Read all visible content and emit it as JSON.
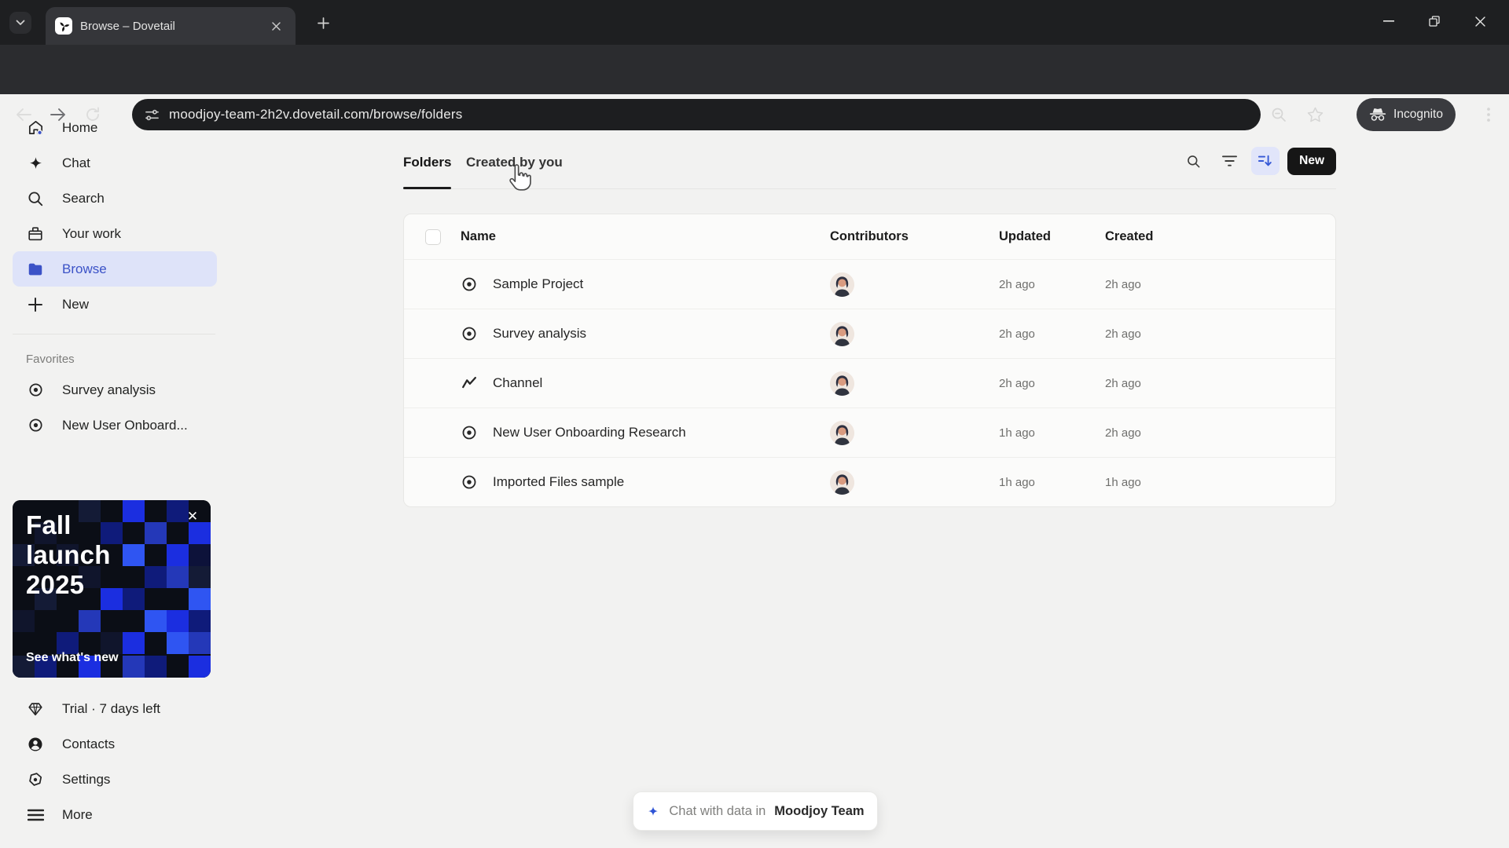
{
  "browser": {
    "tab_title": "Browse – Dovetail",
    "url": "moodjoy-team-2h2v.dovetail.com/browse/folders",
    "incognito_label": "Incognito"
  },
  "sidebar": {
    "items": [
      {
        "label": "Home",
        "icon": "home-icon"
      },
      {
        "label": "Chat",
        "icon": "sparkle-icon"
      },
      {
        "label": "Search",
        "icon": "search-icon"
      },
      {
        "label": "Your work",
        "icon": "archive-icon"
      },
      {
        "label": "Browse",
        "icon": "folder-icon",
        "active": true
      },
      {
        "label": "New",
        "icon": "plus-icon"
      }
    ],
    "favorites_label": "Favorites",
    "favorites": [
      {
        "label": "Survey analysis",
        "icon": "project-icon"
      },
      {
        "label": "New User Onboard...",
        "icon": "project-icon"
      }
    ],
    "promo": {
      "title": "Fall\nlaunch\n2025",
      "cta": "See what's new",
      "close_glyph": "✕",
      "accent_blue": "#1b2ee0"
    },
    "footer_items": [
      {
        "label": "Trial · 7 days left",
        "icon": "gem-icon"
      },
      {
        "label": "Contacts",
        "icon": "person-icon"
      },
      {
        "label": "Settings",
        "icon": "settings-icon"
      },
      {
        "label": "More",
        "icon": "more-icon"
      }
    ]
  },
  "main": {
    "tabs": [
      {
        "label": "Folders",
        "active": true
      },
      {
        "label": "Created by you",
        "active": false
      }
    ],
    "actions": {
      "new_button_label": "New",
      "icons": [
        "search-icon",
        "filter-icon",
        "sort-icon"
      ]
    },
    "table": {
      "headers": [
        "Name",
        "Contributors",
        "Updated",
        "Created"
      ],
      "rows": [
        {
          "name": "Sample Project",
          "icon": "project-icon",
          "updated": "2h ago",
          "created": "2h ago"
        },
        {
          "name": "Survey analysis",
          "icon": "project-icon",
          "updated": "2h ago",
          "created": "2h ago"
        },
        {
          "name": "Channel",
          "icon": "channel-icon",
          "updated": "2h ago",
          "created": "2h ago"
        },
        {
          "name": "New User Onboarding Research",
          "icon": "project-icon",
          "updated": "1h ago",
          "created": "2h ago"
        },
        {
          "name": "Imported Files sample",
          "icon": "project-icon",
          "updated": "1h ago",
          "created": "1h ago"
        }
      ]
    },
    "chat_pill": {
      "prefix": "Chat with data in",
      "team": "Moodjoy Team"
    }
  },
  "colors": {
    "sidebar_active_bg": "#dee3f9",
    "sidebar_active_text": "#3b52c7",
    "sort_icon_blue": "#3558d6",
    "new_button_bg": "#161616",
    "chrome_frame": "#1e1f21",
    "chrome_toolbar": "#2b2c2f"
  }
}
